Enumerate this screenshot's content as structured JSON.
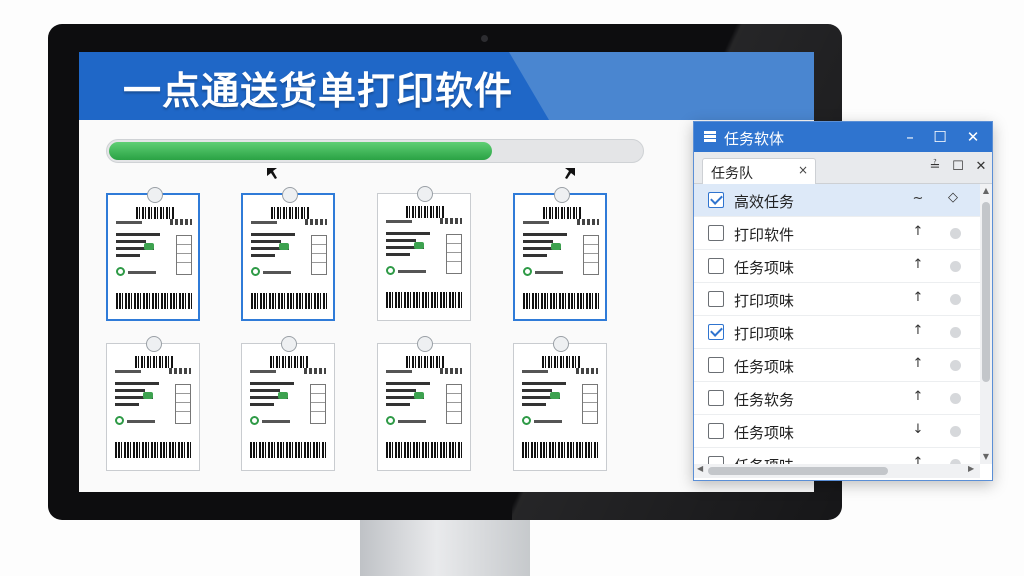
{
  "app": {
    "title": "一点通送货单打印软件",
    "progress": 0.72
  },
  "colors": {
    "banner_dark": "#1f67c7",
    "banner_light": "#4a86d0",
    "progress": "#2aa244",
    "selection": "#2f7bd8"
  },
  "labels": [
    {
      "selected": true
    },
    {
      "selected": true
    },
    {
      "selected": false
    },
    {
      "selected": true
    },
    {
      "selected": false
    },
    {
      "selected": false
    },
    {
      "selected": false
    },
    {
      "selected": false
    }
  ],
  "task_window": {
    "title": "任务软体",
    "title_icon": "printer-stack-icon",
    "buttons": {
      "minimize": "–",
      "maximize": "☐",
      "close": "✕"
    },
    "tab": {
      "label": "任务队",
      "close": "×"
    },
    "tab_buttons": {
      "menu": "≟",
      "restore": "☐",
      "close": "✕"
    },
    "rows": [
      {
        "name": "高效任务",
        "checked": true,
        "active": true,
        "action": "~",
        "status": "◇"
      },
      {
        "name": "打印软件",
        "checked": false,
        "active": false,
        "action": "↑",
        "status": ""
      },
      {
        "name": "任务项味",
        "checked": false,
        "active": false,
        "action": "↑",
        "status": ""
      },
      {
        "name": "打印项味",
        "checked": false,
        "active": false,
        "action": "↑",
        "status": ""
      },
      {
        "name": "打印项味",
        "checked": true,
        "active": false,
        "action": "↑",
        "status": ""
      },
      {
        "name": "任务项味",
        "checked": false,
        "active": false,
        "action": "↑",
        "status": ""
      },
      {
        "name": "任务软务",
        "checked": false,
        "active": false,
        "action": "↑",
        "status": ""
      },
      {
        "name": "任务项味",
        "checked": false,
        "active": false,
        "action": "↓",
        "status": ""
      },
      {
        "name": "任务项味",
        "checked": false,
        "active": false,
        "action": "↑",
        "status": ""
      }
    ]
  }
}
